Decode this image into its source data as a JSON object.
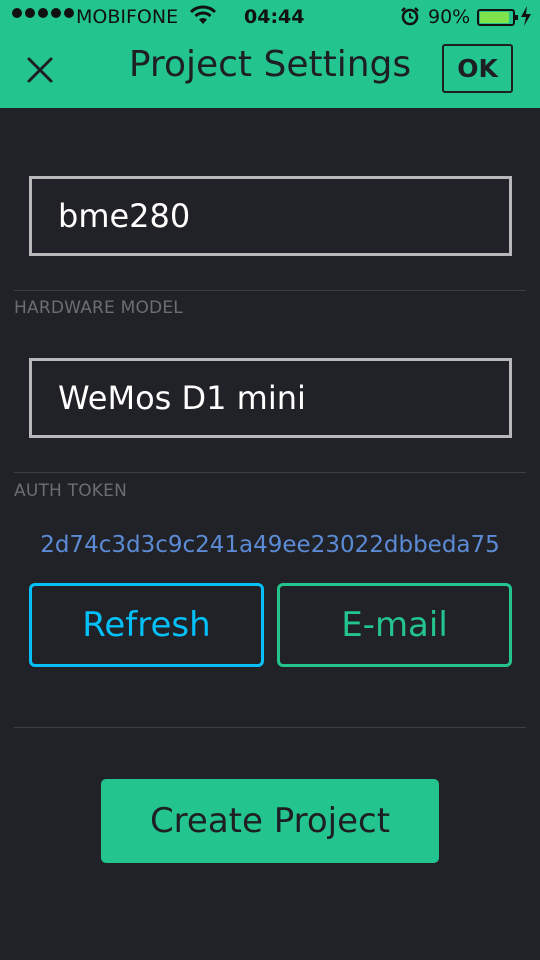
{
  "status_bar": {
    "carrier": "MOBIFONE",
    "time": "04:44",
    "battery_percent": "90%",
    "battery_level": 0.9,
    "icons": [
      "signal-dots-icon",
      "wifi-icon",
      "alarm-icon",
      "battery-icon",
      "charging-bolt-icon"
    ]
  },
  "header": {
    "title": "Project Settings",
    "ok_label": "OK",
    "close_icon": "close-icon"
  },
  "project": {
    "name_value": "bme280"
  },
  "hardware": {
    "label": "HARDWARE MODEL",
    "value": "WeMos D1 mini"
  },
  "auth": {
    "label": "AUTH TOKEN",
    "token": "2d74c3d3c9c241a49ee23022dbbeda75",
    "refresh_label": "Refresh",
    "email_label": "E-mail"
  },
  "actions": {
    "create_label": "Create Project"
  },
  "colors": {
    "header_bg": "#23c48e",
    "body_bg": "#212227",
    "refresh": "#04c0f8",
    "email": "#23c48e",
    "token": "#5c8bd6"
  }
}
